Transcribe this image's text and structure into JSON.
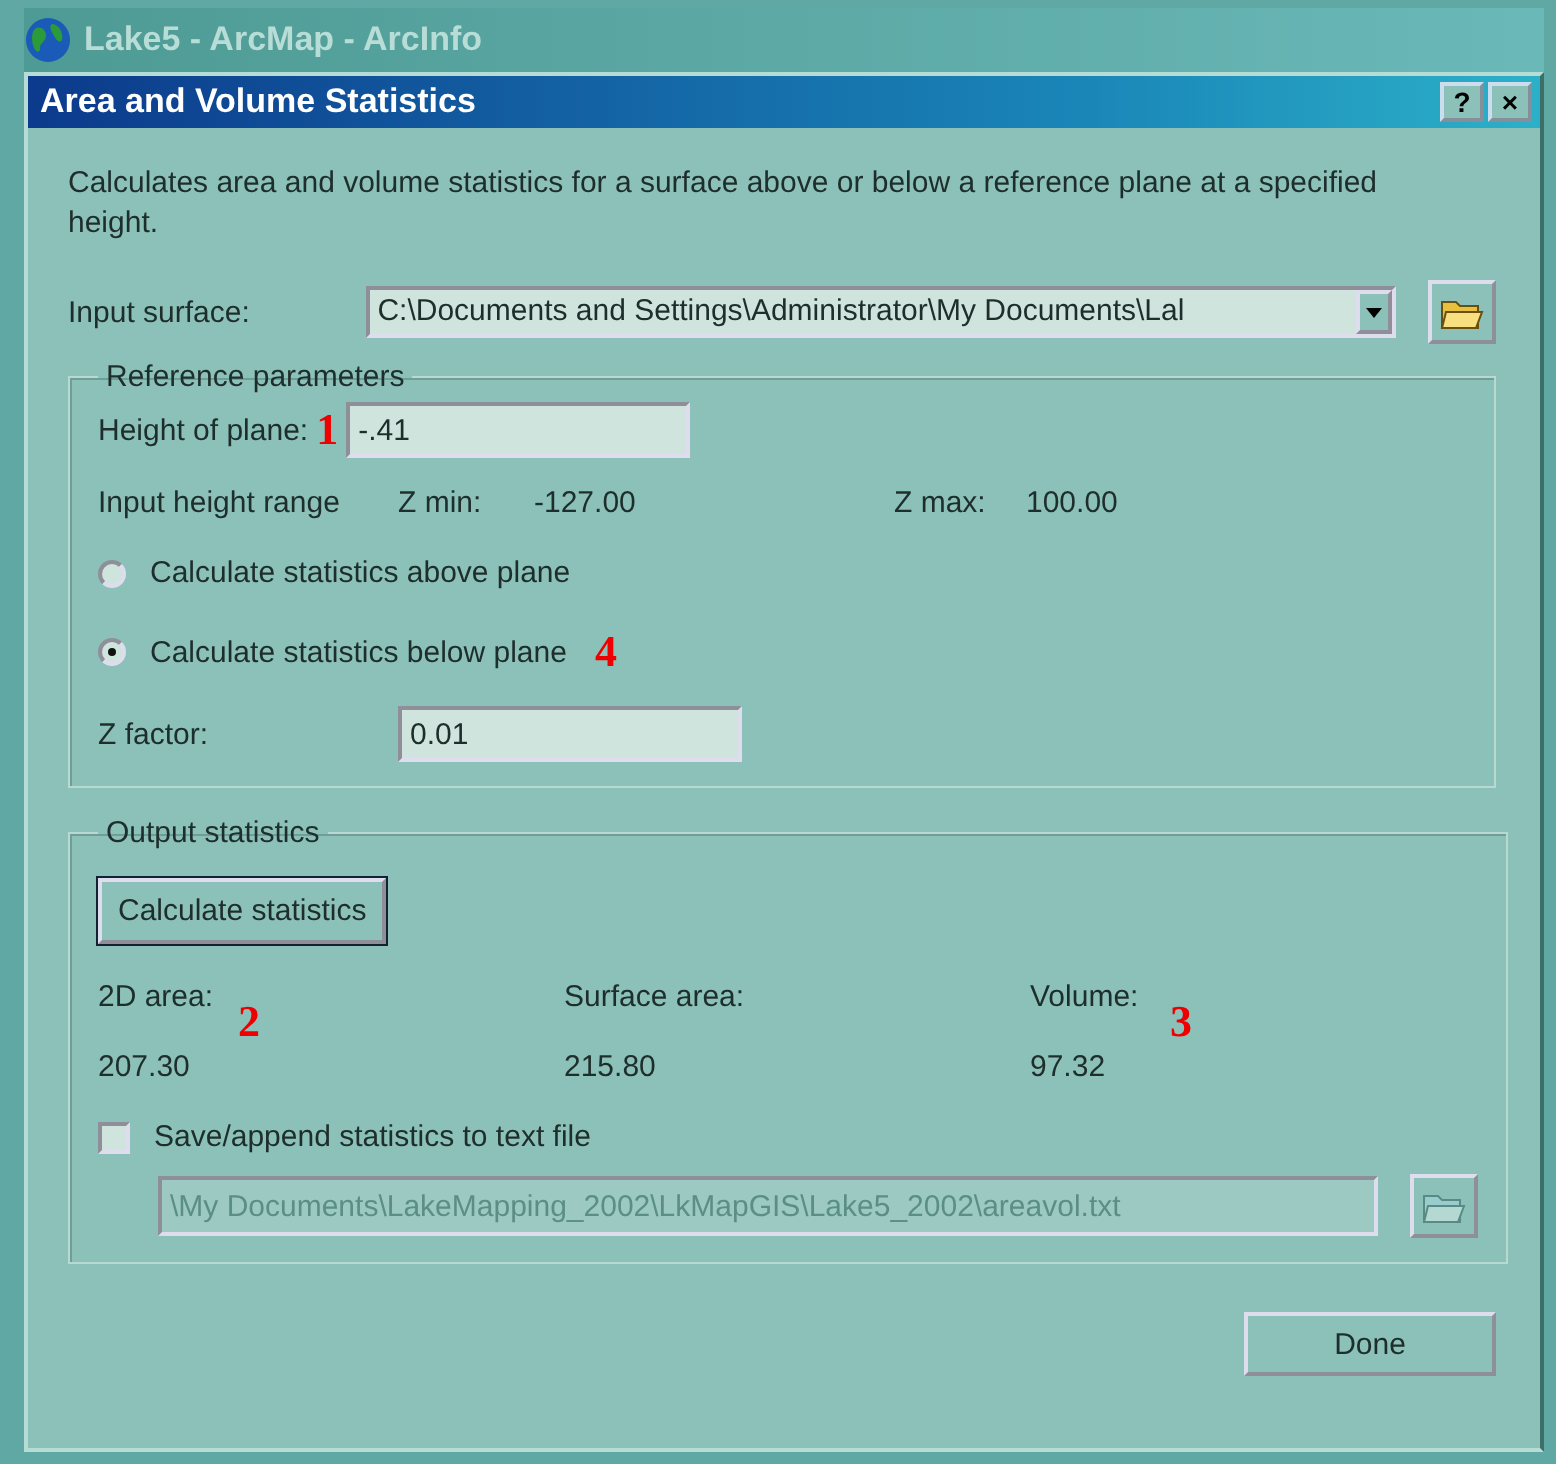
{
  "app_window": {
    "title": "Lake5 - ArcMap - ArcInfo"
  },
  "dialog": {
    "title": "Area and Volume Statistics",
    "title_buttons": [
      "?",
      "×"
    ]
  },
  "description": "Calculates area and volume statistics for a surface above or below a reference plane at a specified height.",
  "input_surface": {
    "label": "Input surface:",
    "value": "C:\\Documents and Settings\\Administrator\\My Documents\\Lal"
  },
  "reference_parameters": {
    "title": "Reference parameters",
    "height_of_plane": {
      "label": "Height of plane:",
      "annotation": "1",
      "value": "-.41"
    },
    "height_range": {
      "label": "Input height range",
      "zmin_label": "Z min:",
      "zmin": "-127.00",
      "zmax_label": "Z max:",
      "zmax": "100.00"
    },
    "options": [
      {
        "label": "Calculate statistics above plane",
        "selected": false
      },
      {
        "label": "Calculate statistics below plane",
        "selected": true,
        "annotation": "4"
      }
    ],
    "z_factor": {
      "label": "Z factor:",
      "value": "0.01"
    }
  },
  "output_statistics": {
    "title": "Output statistics",
    "button": "Calculate statistics",
    "stats": [
      {
        "label": "2D area:",
        "value": "207.30",
        "annotation": "2"
      },
      {
        "label": "Surface area:",
        "value": "215.80"
      },
      {
        "label": "Volume:",
        "value": "97.32",
        "annotation": "3"
      }
    ],
    "save": {
      "label": "Save/append statistics to text file",
      "checked": false
    },
    "file": {
      "value": "\\My Documents\\LakeMapping_2002\\LkMapGIS\\Lake5_2002\\areavol.txt",
      "disabled": true
    }
  },
  "buttons": [
    "Done"
  ]
}
